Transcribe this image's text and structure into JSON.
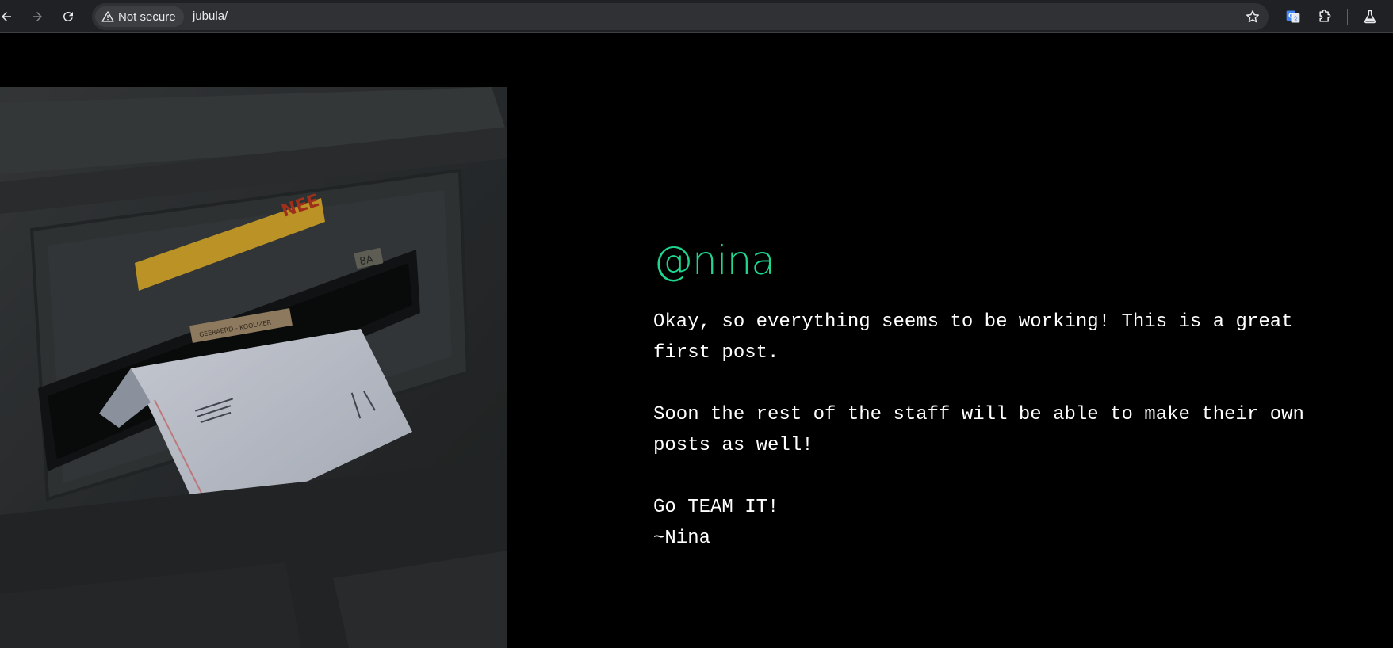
{
  "browser": {
    "security_label": "Not secure",
    "url": "jubula/",
    "icons": {
      "back": "back-arrow-icon",
      "forward": "forward-arrow-icon",
      "reload": "reload-icon",
      "security": "warning-triangle-icon",
      "bookmark": "star-icon",
      "translate": "google-translate-icon",
      "extensions": "puzzle-piece-icon",
      "labs": "flask-icon"
    }
  },
  "post": {
    "author": "@nina",
    "author_color": "#20d68f",
    "paragraphs": [
      "Okay, so everything seems to be working! This is a great first post.",
      "Soon the rest of the staff will be able to make their own posts as well!",
      "Go TEAM IT!\n~Nina"
    ]
  },
  "hero_image": {
    "subject": "mail-slot-with-envelope",
    "labels": [
      "NEE",
      "8A",
      "GEERAERD - KOOLIZER"
    ]
  }
}
